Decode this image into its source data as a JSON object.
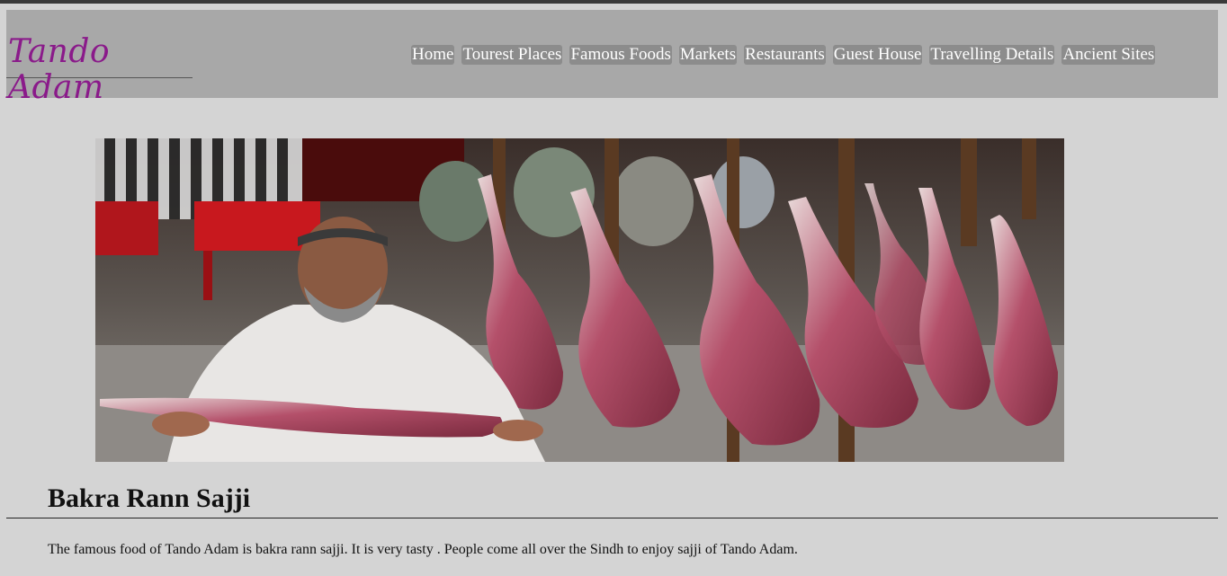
{
  "site": {
    "logo_text": "Tando Adam"
  },
  "nav": {
    "items": [
      {
        "label": "Home"
      },
      {
        "label": "Tourest Places"
      },
      {
        "label": "Famous Foods"
      },
      {
        "label": "Markets"
      },
      {
        "label": "Restaurants"
      },
      {
        "label": "Guest House"
      },
      {
        "label": "Travelling Details"
      },
      {
        "label": "Ancient Sites"
      }
    ]
  },
  "main": {
    "title": "Bakra Rann Sajji",
    "description": "The famous food of Tando Adam is bakra rann sajji. It is very tasty . People come all over the Sindh to enjoy sajji of Tando Adam."
  },
  "colors": {
    "logo": "#8a1a8a",
    "header_bg": "#a8a8a8",
    "page_bg": "#d4d4d4",
    "nav_item_bg": "#8c8c8c"
  }
}
